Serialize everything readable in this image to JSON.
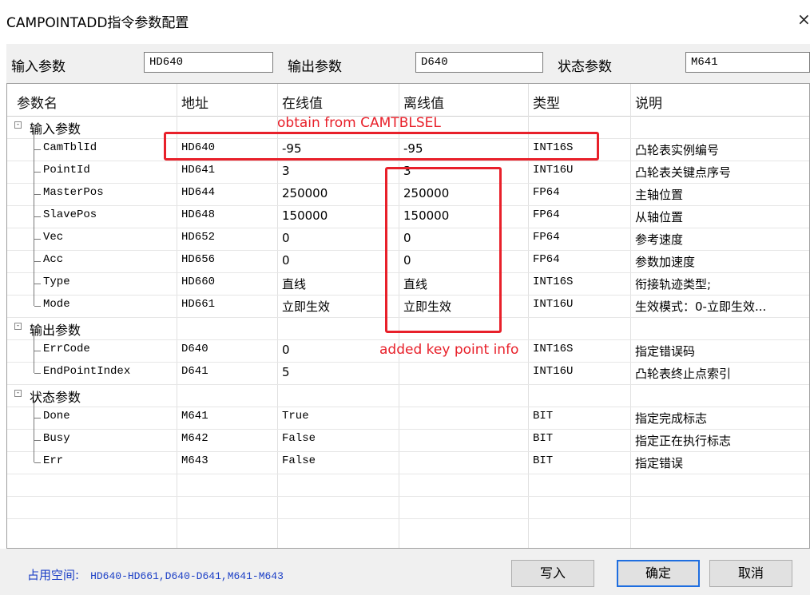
{
  "window": {
    "title": "CAMPOINTADD指令参数配置",
    "close_glyph": "×"
  },
  "params": {
    "input_label": "输入参数",
    "input_value": "HD640",
    "output_label": "输出参数",
    "output_value": "D640",
    "status_label": "状态参数",
    "status_value": "M641"
  },
  "columns": [
    "参数名",
    "地址",
    "在线值",
    "离线值",
    "类型",
    "说明"
  ],
  "groups": [
    {
      "name": "输入参数",
      "expander": "-",
      "rows": [
        {
          "name": "CamTblId",
          "addr": "HD640",
          "online": "-95",
          "offline": "-95",
          "type": "INT16S",
          "desc": "凸轮表实例编号"
        },
        {
          "name": "PointId",
          "addr": "HD641",
          "online": "3",
          "offline": "3",
          "type": "INT16U",
          "desc": "凸轮表关键点序号"
        },
        {
          "name": "MasterPos",
          "addr": "HD644",
          "online": "250000",
          "offline": "250000",
          "type": "FP64",
          "desc": "主轴位置"
        },
        {
          "name": "SlavePos",
          "addr": "HD648",
          "online": "150000",
          "offline": "150000",
          "type": "FP64",
          "desc": "从轴位置"
        },
        {
          "name": "Vec",
          "addr": "HD652",
          "online": "0",
          "offline": "0",
          "type": "FP64",
          "desc": "参考速度"
        },
        {
          "name": "Acc",
          "addr": "HD656",
          "online": "0",
          "offline": "0",
          "type": "FP64",
          "desc": "参数加速度"
        },
        {
          "name": "Type",
          "addr": "HD660",
          "online": "直线",
          "offline": "直线",
          "type": "INT16S",
          "desc": "衔接轨迹类型;"
        },
        {
          "name": "Mode",
          "addr": "HD661",
          "online": "立即生效",
          "offline": "立即生效",
          "type": "INT16U",
          "desc": "生效模式：0-立即生效..."
        }
      ]
    },
    {
      "name": "输出参数",
      "expander": "-",
      "rows": [
        {
          "name": "ErrCode",
          "addr": "D640",
          "online": "0",
          "offline": "",
          "type": "INT16S",
          "desc": "指定错误码"
        },
        {
          "name": "EndPointIndex",
          "addr": "D641",
          "online": "5",
          "offline": "",
          "type": "INT16U",
          "desc": "凸轮表终止点索引"
        }
      ]
    },
    {
      "name": "状态参数",
      "expander": "-",
      "rows": [
        {
          "name": "Done",
          "addr": "M641",
          "online": "True",
          "offline": "",
          "type": "BIT",
          "desc": "指定完成标志"
        },
        {
          "name": "Busy",
          "addr": "M642",
          "online": "False",
          "offline": "",
          "type": "BIT",
          "desc": "指定正在执行标志"
        },
        {
          "name": "Err",
          "addr": "M643",
          "online": "False",
          "offline": "",
          "type": "BIT",
          "desc": "指定错误"
        }
      ]
    }
  ],
  "annotations": {
    "obtain": "obtain from CAMTBLSEL",
    "added": "added key point info",
    "color": "#e8202a"
  },
  "footer": {
    "occupied_label": "占用空间:",
    "occupied_value": "HD640-HD661,D640-D641,M641-M643",
    "write_button": "写入",
    "ok_button": "确定",
    "cancel_button": "取消"
  }
}
